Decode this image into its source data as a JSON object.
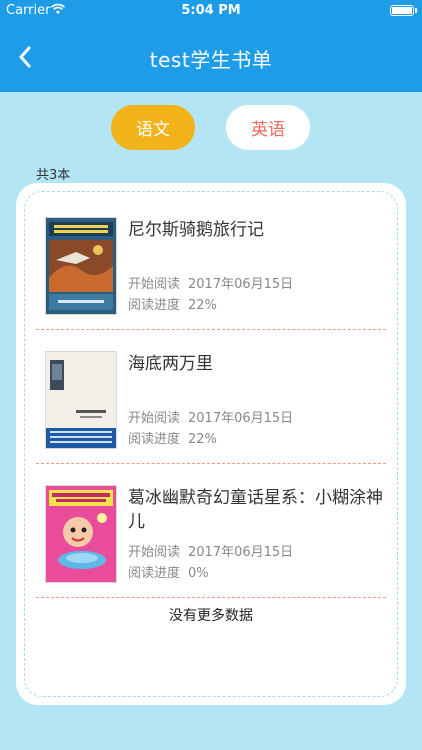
{
  "status_bar": {
    "carrier": "Carrier",
    "time": "5:04 PM"
  },
  "nav": {
    "title": "test学生书单"
  },
  "tabs": [
    {
      "label": "语文",
      "active": true
    },
    {
      "label": "英语",
      "active": false
    }
  ],
  "count_text": "共3本",
  "labels": {
    "start": "开始阅读",
    "progress": "阅读进度"
  },
  "books": [
    {
      "title": "尼尔斯骑鹅旅行记",
      "start_date": "2017年06月15日",
      "progress": "22%"
    },
    {
      "title": "海底两万里",
      "start_date": "2017年06月15日",
      "progress": "22%"
    },
    {
      "title": "葛冰幽默奇幻童话星系：小糊涂神儿",
      "start_date": "2017年06月15日",
      "progress": "0%"
    }
  ],
  "no_more": "没有更多数据",
  "colors": {
    "nav": "#1e9ce8",
    "background": "#b3e5f5",
    "tab_active": "#f2b31a",
    "tab_inactive_text": "#f06a5a",
    "divider": "#f09a88"
  }
}
